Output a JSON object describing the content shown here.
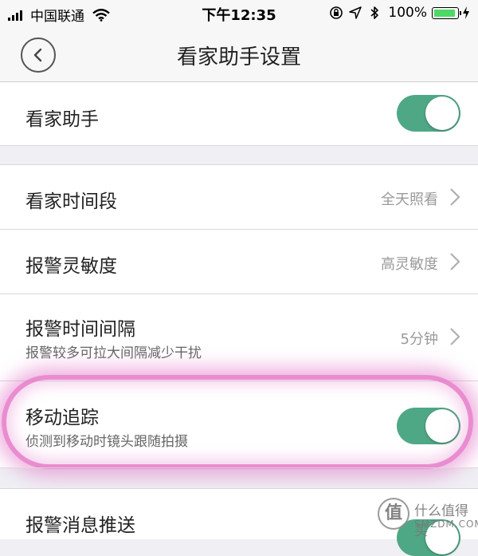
{
  "status_bar": {
    "carrier": "中国联通",
    "time": "下午12:35",
    "battery": "100%",
    "icons": [
      "signal-icon",
      "wifi-icon",
      "rotation-lock-icon",
      "location-icon",
      "bluetooth-icon",
      "battery-icon",
      "charging-icon"
    ]
  },
  "nav": {
    "title": "看家助手设置",
    "back_icon": "chevron-left-icon"
  },
  "settings": {
    "home_assistant": {
      "label": "看家助手",
      "enabled": true
    },
    "period": {
      "label": "看家时间段",
      "value": "全天照看"
    },
    "sensitivity": {
      "label": "报警灵敏度",
      "value": "高灵敏度"
    },
    "interval": {
      "label": "报警时间间隔",
      "sub": "报警较多可拉大间隔减少干扰",
      "value": "5分钟"
    },
    "motion_tracking": {
      "label": "移动追踪",
      "sub": "侦测到移动时镜头跟随拍摄",
      "enabled": true
    },
    "push": {
      "label": "报警消息推送",
      "enabled": true
    }
  },
  "watermark": {
    "badge": "值",
    "text": "什么值得买",
    "sub": "SMZDM.COM"
  },
  "colors": {
    "toggle_on": "#4fa885",
    "highlight": "#e678c8",
    "background": "#efeff4"
  }
}
